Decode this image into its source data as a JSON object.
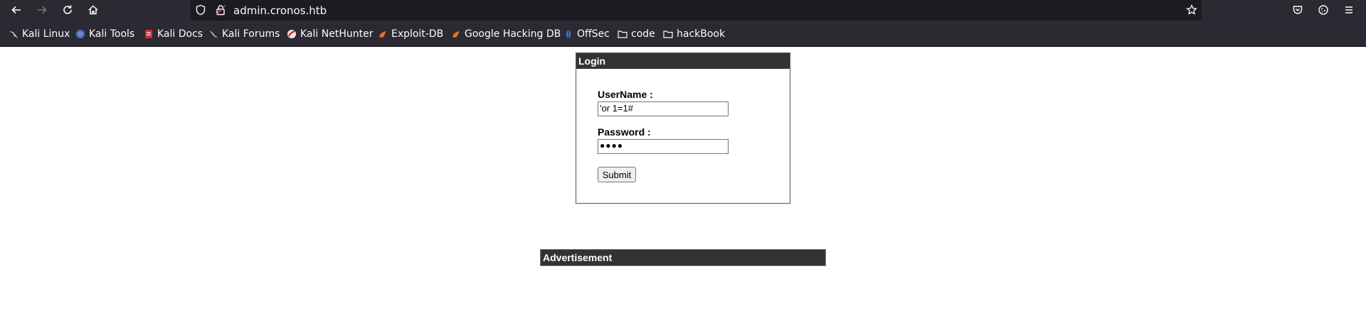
{
  "browser": {
    "url": "admin.cronos.htb",
    "bookmarks": [
      {
        "label": "Kali Linux",
        "icon": "kali-dragon-icon"
      },
      {
        "label": "Kali Tools",
        "icon": "kali-tools-icon"
      },
      {
        "label": "Kali Docs",
        "icon": "kali-docs-icon"
      },
      {
        "label": "Kali Forums",
        "icon": "kali-forums-icon"
      },
      {
        "label": "Kali NetHunter",
        "icon": "nethunter-icon"
      },
      {
        "label": "Exploit-DB",
        "icon": "exploit-db-icon"
      },
      {
        "label": "Google Hacking DB",
        "icon": "ghdb-icon"
      },
      {
        "label": "OffSec",
        "icon": "offsec-icon"
      },
      {
        "label": "code",
        "icon": "folder-icon"
      },
      {
        "label": "hackBook",
        "icon": "folder-icon"
      }
    ]
  },
  "login": {
    "title": "Login",
    "username_label": "UserName :",
    "username_value": "'or 1=1#",
    "password_label": "Password :",
    "password_value": "●●●●",
    "submit_label": "Submit"
  },
  "advertisement": {
    "title": "Advertisement"
  },
  "colors": {
    "chrome_bg": "#2b2a33",
    "urlbar_bg": "#1c1b22",
    "panel_header": "#333333"
  }
}
